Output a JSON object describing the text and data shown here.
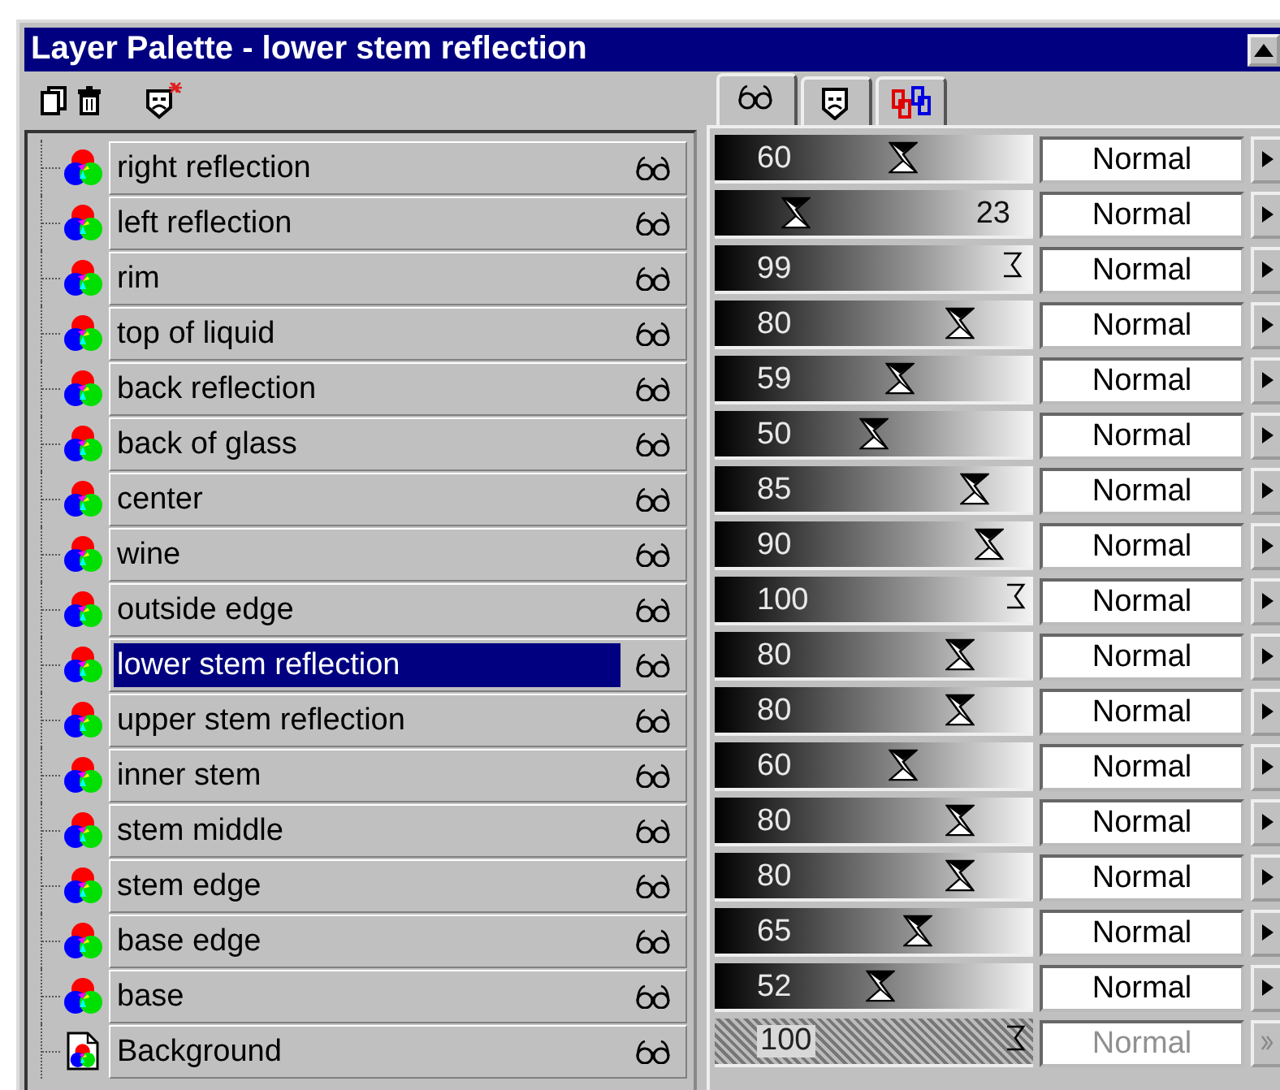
{
  "window": {
    "title": "Layer Palette - lower stem reflection"
  },
  "tabs": [
    {
      "kind": "visibility",
      "selected": true
    },
    {
      "kind": "mask",
      "selected": false
    },
    {
      "kind": "links",
      "selected": false
    }
  ],
  "layers": [
    {
      "name": "right reflection",
      "kind": "vector",
      "selected": false,
      "disabled": false,
      "opacity": "60",
      "level": 0.6,
      "blend_mode": "Normal"
    },
    {
      "name": "left reflection",
      "kind": "vector",
      "selected": false,
      "disabled": false,
      "opacity": "23",
      "level": 0.23,
      "blend_mode": "Normal"
    },
    {
      "name": "rim",
      "kind": "vector",
      "selected": false,
      "disabled": false,
      "opacity": "99",
      "level": 0.99,
      "blend_mode": "Normal"
    },
    {
      "name": "top of liquid",
      "kind": "vector",
      "selected": false,
      "disabled": false,
      "opacity": "80",
      "level": 0.8,
      "blend_mode": "Normal"
    },
    {
      "name": "back reflection",
      "kind": "vector",
      "selected": false,
      "disabled": false,
      "opacity": "59",
      "level": 0.59,
      "blend_mode": "Normal"
    },
    {
      "name": "back of glass",
      "kind": "vector",
      "selected": false,
      "disabled": false,
      "opacity": "50",
      "level": 0.5,
      "blend_mode": "Normal"
    },
    {
      "name": "center",
      "kind": "vector",
      "selected": false,
      "disabled": false,
      "opacity": "85",
      "level": 0.85,
      "blend_mode": "Normal"
    },
    {
      "name": "wine",
      "kind": "vector",
      "selected": false,
      "disabled": false,
      "opacity": "90",
      "level": 0.9,
      "blend_mode": "Normal"
    },
    {
      "name": "outside edge",
      "kind": "vector",
      "selected": false,
      "disabled": false,
      "opacity": "100",
      "level": 1,
      "blend_mode": "Normal"
    },
    {
      "name": "lower stem reflection",
      "kind": "vector",
      "selected": true,
      "disabled": false,
      "opacity": "80",
      "level": 0.8,
      "blend_mode": "Normal"
    },
    {
      "name": "upper stem reflection",
      "kind": "vector",
      "selected": false,
      "disabled": false,
      "opacity": "80",
      "level": 0.8,
      "blend_mode": "Normal"
    },
    {
      "name": "inner stem",
      "kind": "vector",
      "selected": false,
      "disabled": false,
      "opacity": "60",
      "level": 0.6,
      "blend_mode": "Normal"
    },
    {
      "name": "stem middle",
      "kind": "vector",
      "selected": false,
      "disabled": false,
      "opacity": "80",
      "level": 0.8,
      "blend_mode": "Normal"
    },
    {
      "name": "stem edge",
      "kind": "vector",
      "selected": false,
      "disabled": false,
      "opacity": "80",
      "level": 0.8,
      "blend_mode": "Normal"
    },
    {
      "name": "base edge",
      "kind": "vector",
      "selected": false,
      "disabled": false,
      "opacity": "65",
      "level": 0.65,
      "blend_mode": "Normal"
    },
    {
      "name": "base",
      "kind": "vector",
      "selected": false,
      "disabled": false,
      "opacity": "52",
      "level": 0.52,
      "blend_mode": "Normal"
    },
    {
      "name": "Background",
      "kind": "raster",
      "selected": false,
      "disabled": true,
      "opacity": "100",
      "level": 1,
      "blend_mode": "Normal"
    }
  ]
}
